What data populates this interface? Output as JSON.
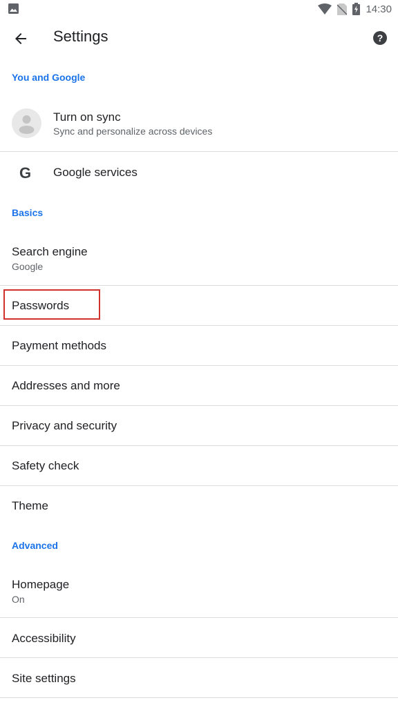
{
  "status_bar": {
    "left_icon": "image-notification-icon",
    "icons": [
      "wifi-icon",
      "no-sim-icon",
      "battery-charging-icon"
    ],
    "time": "14:30"
  },
  "toolbar": {
    "back_icon": "arrow-back-icon",
    "title": "Settings",
    "help_icon": "help-icon"
  },
  "sections": {
    "you_and_google": "You and Google",
    "basics": "Basics",
    "advanced": "Advanced"
  },
  "items": {
    "sync": {
      "title": "Turn on sync",
      "subtitle": "Sync and personalize across devices",
      "icon": "account-avatar-icon"
    },
    "google_services": {
      "title": "Google services",
      "icon": "google-g-icon",
      "glyph": "G"
    },
    "search_engine": {
      "title": "Search engine",
      "subtitle": "Google"
    },
    "passwords": {
      "title": "Passwords"
    },
    "payment_methods": {
      "title": "Payment methods"
    },
    "addresses": {
      "title": "Addresses and more"
    },
    "privacy": {
      "title": "Privacy and security"
    },
    "safety_check": {
      "title": "Safety check"
    },
    "theme": {
      "title": "Theme"
    },
    "homepage": {
      "title": "Homepage",
      "subtitle": "On"
    },
    "accessibility": {
      "title": "Accessibility"
    },
    "site_settings": {
      "title": "Site settings"
    }
  },
  "annotation": {
    "highlighted_item": "Passwords",
    "color": "#d0312d"
  },
  "colors": {
    "accent": "#1a73e8",
    "text": "#202124",
    "secondary": "#5f6368",
    "divider": "#dadce0"
  }
}
